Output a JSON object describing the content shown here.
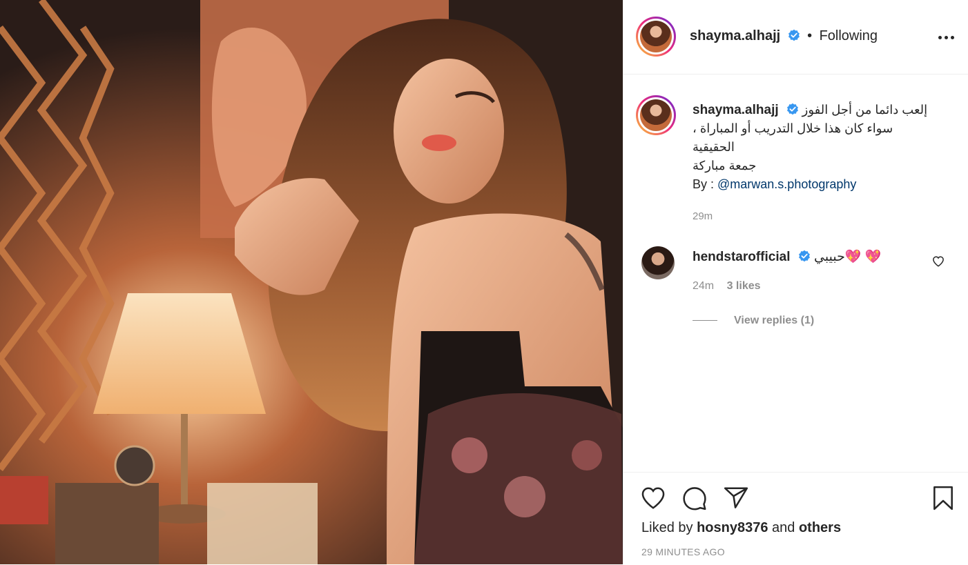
{
  "post": {
    "username": "shayma.alhajj",
    "follow_separator": "•",
    "follow_status": "Following",
    "caption_lines": [
      "إلعب دائما من أجل الفوز",
      "، سواء كان هذا خلال التدريب أو المباراة",
      "الحقيقية",
      "جمعة مباركة"
    ],
    "credit_prefix": "By : ",
    "credit_link": "@marwan.s.photography",
    "caption_time": "29m"
  },
  "comment": {
    "username": "hendstarofficial",
    "text": "حبيبي💖 💖",
    "time": "24m",
    "likes": "3 likes",
    "view_replies": "View replies (1)"
  },
  "footer": {
    "liked_by_prefix": "Liked by",
    "liked_by_user": "hosny8376",
    "liked_by_and": "and",
    "liked_by_others": "others",
    "posted_ago": "29 MINUTES AGO"
  },
  "icons": {
    "more": "more-options-icon",
    "verified": "verified-badge-icon",
    "like": "heart-icon",
    "comment": "comment-icon",
    "share": "share-icon",
    "save": "bookmark-icon"
  },
  "colors": {
    "verified": "#3897f0",
    "link": "#00376b",
    "muted": "#8e8e8e",
    "text": "#262626"
  }
}
